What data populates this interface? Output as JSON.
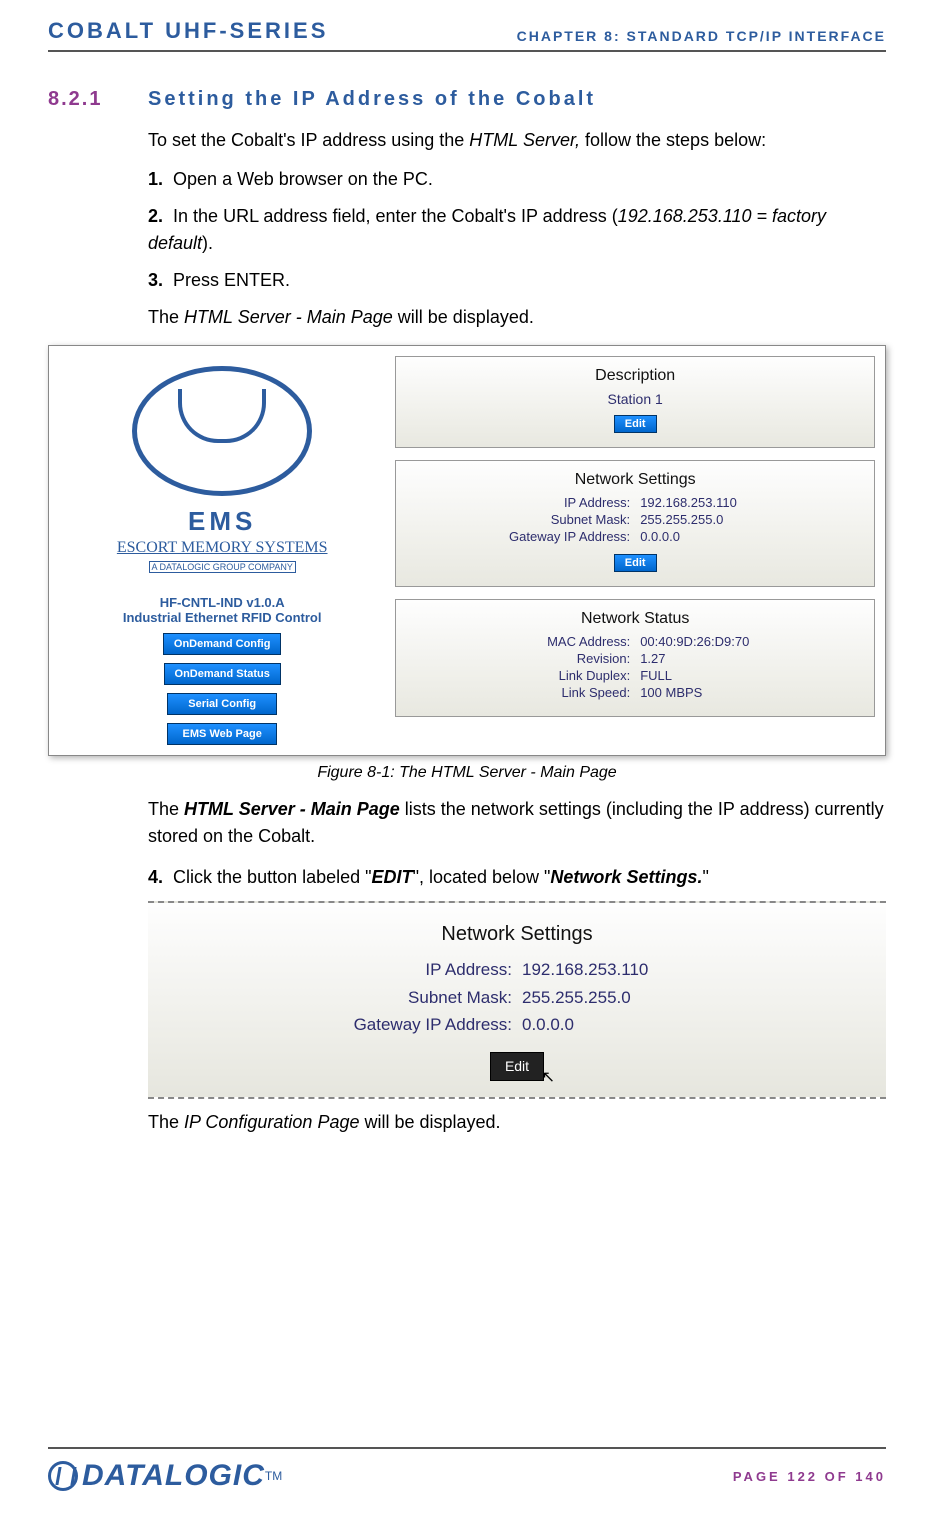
{
  "header": {
    "left": "COBALT UHF-SERIES",
    "right": "CHAPTER 8: STANDARD TCP/IP INTERFACE"
  },
  "section": {
    "number": "8.2.1",
    "title": "Setting the IP Address of the Cobalt"
  },
  "intro_a": "To set the Cobalt's IP address using the ",
  "intro_b": "HTML Server,",
  "intro_c": " follow the steps below:",
  "steps": [
    {
      "n": "1.",
      "t": "Open a Web browser on the PC."
    },
    {
      "n": "2.",
      "t_a": "In the URL address field, enter the Cobalt's IP address (",
      "t_i": "192.168.253.110 = factory default",
      "t_b": ")."
    },
    {
      "n": "3.",
      "t": "Press ENTER."
    }
  ],
  "display_line_a": "The ",
  "display_line_i": "HTML Server - Main Page",
  "display_line_b": " will be displayed.",
  "fig1": {
    "logo_big": "EMS",
    "logo_sub": "ESCORT MEMORY SYSTEMS",
    "logo_sub2": "A DATALOGIC GROUP COMPANY",
    "ctrl1": "HF-CNTL-IND v1.0.A",
    "ctrl2": "Industrial Ethernet RFID Control",
    "buttons": [
      "OnDemand Config",
      "OnDemand Status",
      "Serial Config",
      "EMS Web Page"
    ],
    "desc_title": "Description",
    "desc_value": "Station 1",
    "edit": "Edit",
    "net_title": "Network Settings",
    "net_rows": [
      {
        "lbl": "IP Address:",
        "val": "192.168.253.110"
      },
      {
        "lbl": "Subnet Mask:",
        "val": "255.255.255.0"
      },
      {
        "lbl": "Gateway IP Address:",
        "val": "0.0.0.0"
      }
    ],
    "status_title": "Network Status",
    "status_rows": [
      {
        "lbl": "MAC Address:",
        "val": "00:40:9D:26:D9:70"
      },
      {
        "lbl": "Revision:",
        "val": "1.27"
      },
      {
        "lbl": "Link Duplex:",
        "val": "FULL"
      },
      {
        "lbl": "Link Speed:",
        "val": "100 MBPS"
      }
    ],
    "caption": "Figure 8-1: The HTML Server - Main Page"
  },
  "para2_a": "The ",
  "para2_b": "HTML Server - Main Page",
  "para2_c": " lists the network settings (including the IP address) currently stored on the Cobalt.",
  "step4_n": "4.",
  "step4_a": "Click the button labeled \"",
  "step4_b": "EDIT",
  "step4_c": "\", located below \"",
  "step4_d": "Network Settings.",
  "step4_e": "\"",
  "fig2": {
    "title": "Network Settings",
    "rows": [
      {
        "lbl": "IP Address:",
        "val": "192.168.253.110"
      },
      {
        "lbl": "Subnet Mask:",
        "val": "255.255.255.0"
      },
      {
        "lbl": "Gateway IP Address:",
        "val": "0.0.0.0"
      }
    ],
    "edit": "Edit"
  },
  "display2_a": "The ",
  "display2_i": "IP Configuration Page",
  "display2_b": " will be displayed.",
  "footer": {
    "logo": "DATALOGIC",
    "tm": "TM",
    "page": "PAGE 122 OF 140"
  }
}
